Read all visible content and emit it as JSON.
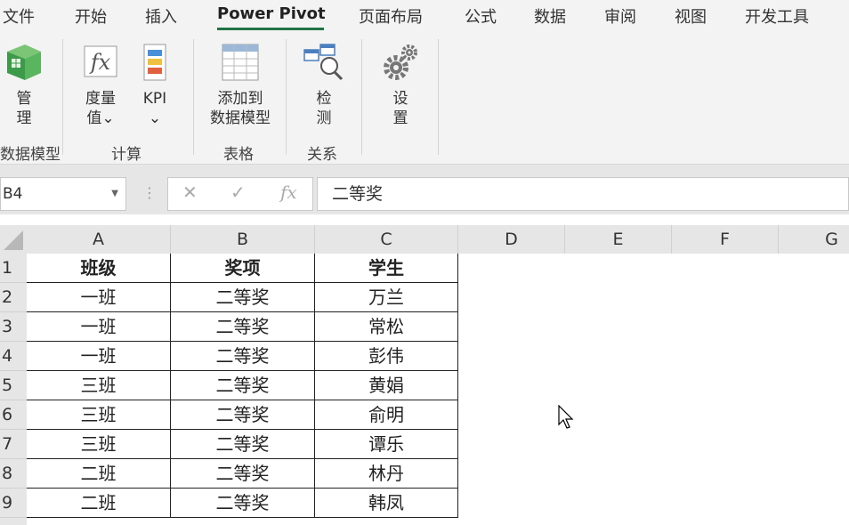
{
  "menu": {
    "tabs": [
      "文件",
      "开始",
      "插入",
      "Power Pivot",
      "页面布局",
      "公式",
      "数据",
      "审阅",
      "视图",
      "开发工具"
    ],
    "active_tab": "Power Pivot"
  },
  "ribbon": {
    "manage": {
      "line1": "管",
      "line2": "理"
    },
    "measures": {
      "line1": "度量",
      "line2": "值⌄"
    },
    "kpi": {
      "line1": "KPI",
      "line2": "⌄"
    },
    "add_to_model": {
      "line1": "添加到",
      "line2": "数据模型"
    },
    "detect": {
      "line1": "检",
      "line2": "测"
    },
    "settings": {
      "line1": "设",
      "line2": "置"
    },
    "groups": {
      "data_model": "数据模型",
      "calculations": "计算",
      "tables": "表格",
      "relationships": "关系"
    }
  },
  "formula_bar": {
    "name_box": "B4",
    "formula": "二等奖",
    "fx": "fx",
    "cancel": "✕",
    "enter": "✓"
  },
  "grid": {
    "columns": [
      "A",
      "B",
      "C",
      "D",
      "E",
      "F",
      "G"
    ],
    "row_numbers": [
      "1",
      "2",
      "3",
      "4",
      "5",
      "6",
      "7",
      "8",
      "9"
    ],
    "rows": [
      [
        "班级",
        "奖项",
        "学生"
      ],
      [
        "一班",
        "二等奖",
        "万兰"
      ],
      [
        "一班",
        "二等奖",
        "常松"
      ],
      [
        "一班",
        "二等奖",
        "彭伟"
      ],
      [
        "三班",
        "二等奖",
        "黄娟"
      ],
      [
        "三班",
        "二等奖",
        "俞明"
      ],
      [
        "三班",
        "二等奖",
        "谭乐"
      ],
      [
        "二班",
        "二等奖",
        "林丹"
      ],
      [
        "二班",
        "二等奖",
        "韩凤"
      ]
    ]
  },
  "colors": {
    "accent": "#217346",
    "ribbon_bg": "#f3f3f3",
    "header_bg": "#e6e6e6"
  }
}
